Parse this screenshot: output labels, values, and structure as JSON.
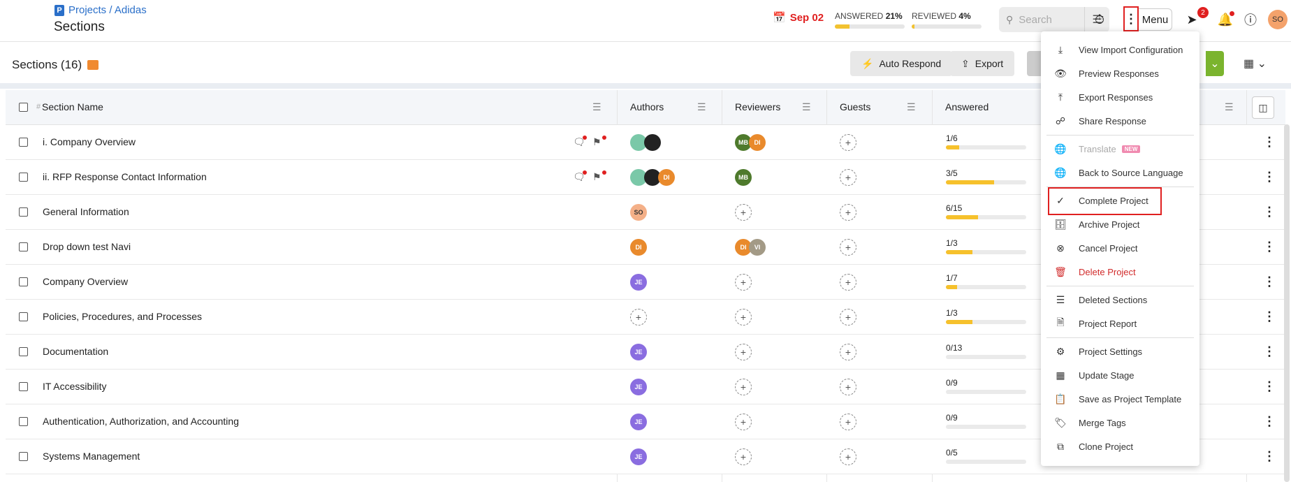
{
  "header": {
    "breadcrumb": "Projects / Adidas",
    "title": "Sections",
    "date": "Sep 02",
    "answered_label": "ANSWERED",
    "answered_pct": "21%",
    "answered_value": 0.21,
    "reviewed_label": "REVIEWED",
    "reviewed_pct": "4%",
    "reviewed_value": 0.04,
    "search_placeholder": "Search",
    "menu_label": "Menu",
    "notification_count": "2",
    "user_initials": "SO"
  },
  "toolbar": {
    "sections_title": "Sections (16)",
    "auto_respond": "Auto Respond",
    "export": "Export"
  },
  "table": {
    "columns": {
      "hash": "#",
      "name": "Section Name",
      "authors": "Authors",
      "reviewers": "Reviewers",
      "guests": "Guests",
      "answered": "Answered"
    },
    "rows": [
      {
        "name": "i. Company Overview",
        "answered": "1/6",
        "progress": 0.167
      },
      {
        "name": "ii. RFP Response Contact Information",
        "answered": "3/5",
        "progress": 0.6
      },
      {
        "name": "General Information",
        "answered": "6/15",
        "progress": 0.4
      },
      {
        "name": "Drop down test Navi",
        "answered": "1/3",
        "progress": 0.333
      },
      {
        "name": "Company Overview",
        "answered": "1/7",
        "progress": 0.143
      },
      {
        "name": "Policies, Procedures, and Processes",
        "answered": "1/3",
        "progress": 0.333
      },
      {
        "name": "Documentation",
        "answered": "0/13",
        "progress": 0
      },
      {
        "name": "IT Accessibility",
        "answered": "0/9",
        "progress": 0
      },
      {
        "name": "Authentication, Authorization, and Accounting",
        "answered": "0/9",
        "progress": 0
      },
      {
        "name": "Systems Management",
        "answered": "0/5",
        "progress": 0
      }
    ],
    "avatars": {
      "mb": "MB",
      "di": "DI",
      "so": "SO",
      "vi": "VI",
      "je": "JE"
    }
  },
  "menu": {
    "items": [
      {
        "label": "View Import Configuration"
      },
      {
        "label": "Preview Responses"
      },
      {
        "label": "Export Responses"
      },
      {
        "label": "Share Response"
      },
      {
        "label": "Translate",
        "badge": "NEW"
      },
      {
        "label": "Back to Source Language"
      },
      {
        "label": "Complete Project"
      },
      {
        "label": "Archive Project"
      },
      {
        "label": "Cancel Project"
      },
      {
        "label": "Delete Project"
      },
      {
        "label": "Deleted Sections"
      },
      {
        "label": "Project Report"
      },
      {
        "label": "Project Settings"
      },
      {
        "label": "Update Stage"
      },
      {
        "label": "Save as Project Template"
      },
      {
        "label": "Merge Tags"
      },
      {
        "label": "Clone Project"
      }
    ]
  },
  "colors": {
    "accent": "#2a6fc9",
    "danger": "#e02020",
    "progress": "#f6c12c",
    "green": "#7bb42e"
  }
}
